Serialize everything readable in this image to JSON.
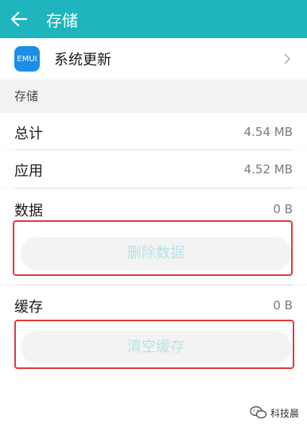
{
  "header": {
    "title": "存储"
  },
  "app": {
    "name": "系统更新",
    "icon_text": "EMUI"
  },
  "section": {
    "title": "存储"
  },
  "rows": {
    "total": {
      "label": "总计",
      "value": "4.54 MB"
    },
    "app": {
      "label": "应用",
      "value": "4.52 MB"
    },
    "data": {
      "label": "数据",
      "value": "0 B"
    },
    "cache": {
      "label": "缓存",
      "value": "0 B"
    }
  },
  "buttons": {
    "clear_data": "删除数据",
    "clear_cache": "清空缓存"
  },
  "watermark": {
    "text": "科技晨"
  },
  "colors": {
    "accent": "#1eb5be",
    "highlight": "#e03a3a",
    "icon": "#1b8fe6"
  }
}
